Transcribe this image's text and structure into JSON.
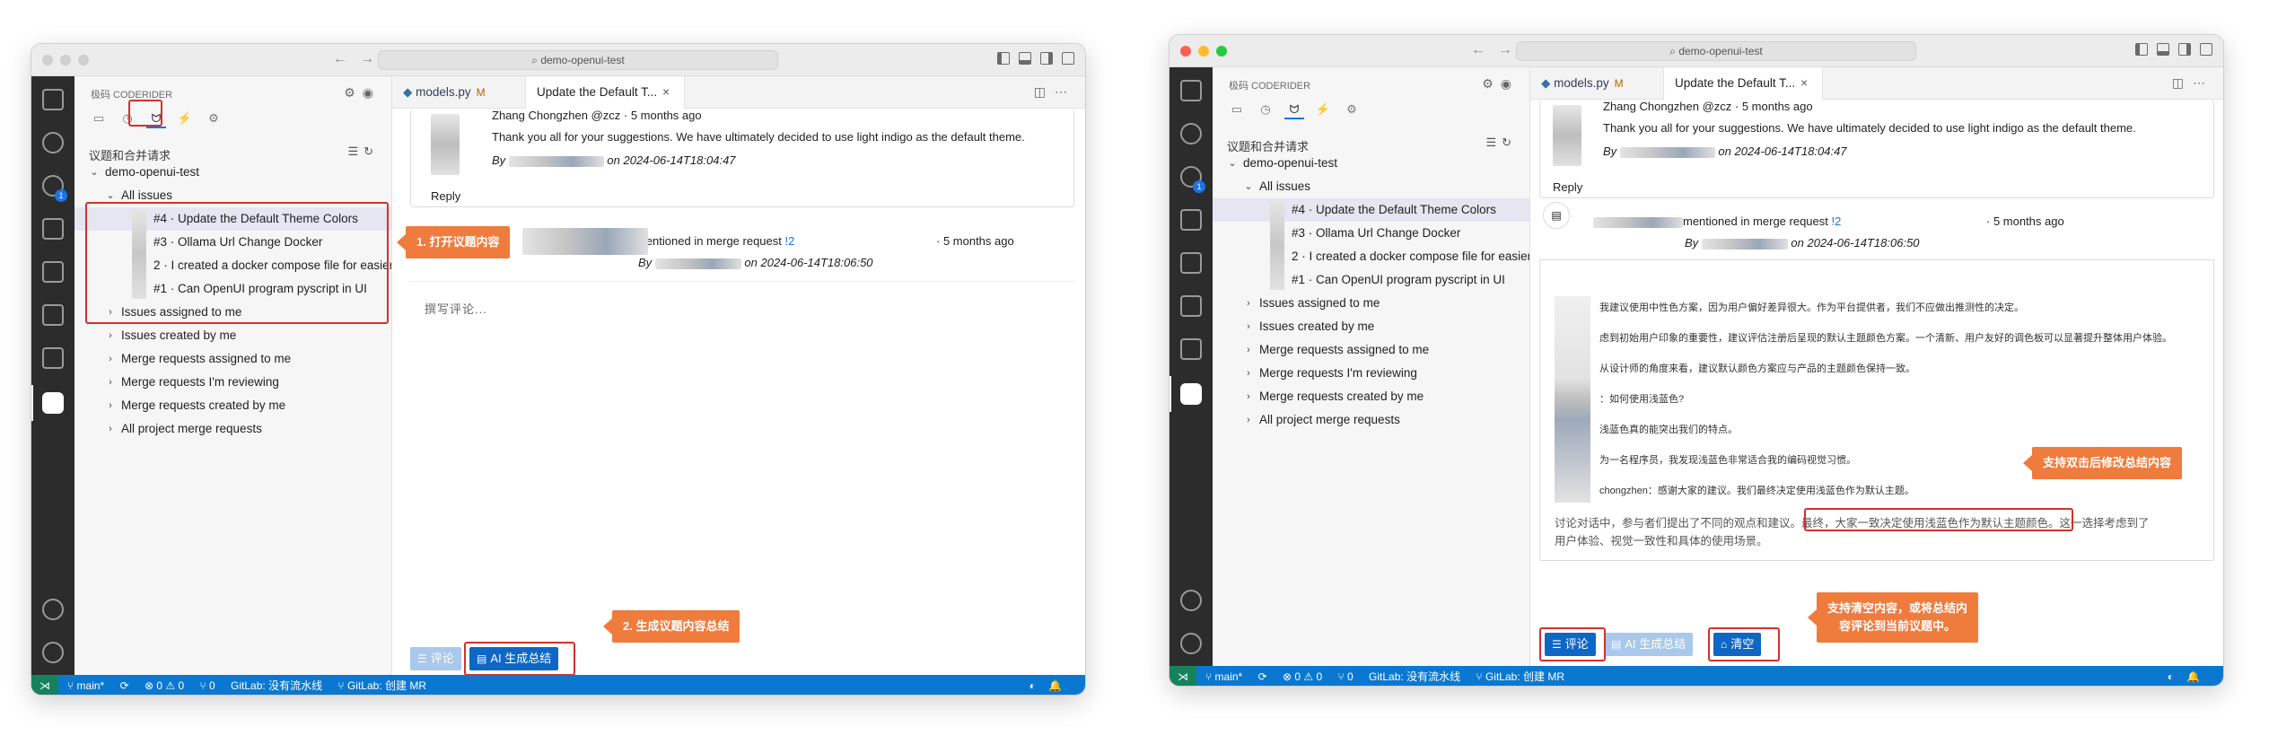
{
  "window": {
    "title": "demo-openui-test"
  },
  "sidebar": {
    "title": "极码 CODERIDER",
    "section": "议题和合并请求",
    "project": "demo-openui-test",
    "all_issues": "All issues",
    "issues": [
      "#4 · Update the Default Theme Colors",
      "#3 · Ollama Url Change Docker",
      "2 · I created a docker compose file for easier start",
      "#1 · Can OpenUI program pyscript in UI"
    ],
    "groups": [
      "Issues assigned to me",
      "Issues created by me",
      "Merge requests assigned to me",
      "Merge requests I'm reviewing",
      "Merge requests created by me",
      "All project merge requests"
    ]
  },
  "tabs": {
    "file": "models.py",
    "file_state": "M",
    "issue": "Update the Default T...",
    "close": "×"
  },
  "comment": {
    "author": "Zhang Chongzhen @zcz · 5 months ago",
    "body": "Thank you all for your suggestions. We have ultimately decided to use light indigo as the default theme.",
    "by": "By",
    "on": "on 2024-06-14T18:04:47",
    "reply": "Reply"
  },
  "mention": {
    "text": "mentioned in merge request",
    "mr": "!2",
    "age": "· 5 months ago",
    "by": "By",
    "on": "on 2024-06-14T18:06:50"
  },
  "editor_left": {
    "placeholder": "撰写评论..."
  },
  "buttons": {
    "comment": "评论",
    "ai_summary": "AI 生成总结",
    "clear": "清空"
  },
  "summary_lines": [
    "我建议使用中性色方案，因为用户偏好差异很大。作为平台提供者，我们不应做出推测性的决定。",
    "虑到初始用户印象的重要性，建议评估注册后呈现的默认主题颜色方案。一个清新、用户友好的调色板可以显著提升整体用户体验。",
    "从设计师的角度来看，建议默认颜色方案应与产品的主题颜色保持一致。",
    "：如何使用浅蓝色?",
    "浅蓝色真的能突出我们的特点。",
    "为一名程序员，我发现浅蓝色非常适合我的编码视觉习惯。",
    "chongzhen：感谢大家的建议。我们最终决定使用浅蓝色作为默认主题。"
  ],
  "summary_conclusion": {
    "part1": "讨论对话中，参与者们提出了不同的观点和建议。",
    "part2": "最终，大家一致决定使用浅蓝色作为默认主题颜色。",
    "part3": "这一选择考虑到了",
    "line2": "用户体验、视觉一致性和具体的使用场景。"
  },
  "statusbar": {
    "branch": "main*",
    "problems": "⊗ 0 ⚠ 0",
    "ports": "⑂ 0",
    "pipeline": "GitLab: 没有流水线",
    "mr": "GitLab: 创建 MR",
    "badge": "1"
  },
  "callouts": {
    "open_issue": "1. 打开议题内容",
    "gen_summary": "2. 生成议题内容总结",
    "edit_summary": "支持双击后修改总结内容",
    "clear_line1": "支持清空内容，或将总结内",
    "clear_line2": "容评论到当前议题中。"
  },
  "colors": {
    "accent": "#0f67c5",
    "callout": "#ef7b3c",
    "highlight": "#d4312b",
    "statusbar": "#0a78d1"
  }
}
